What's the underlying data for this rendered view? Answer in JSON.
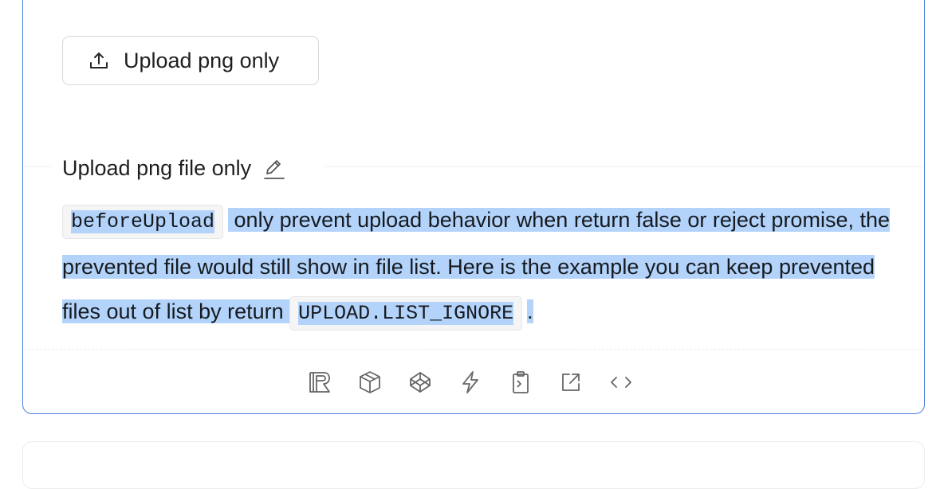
{
  "upload_button": {
    "label": "Upload png only",
    "icon": "upload-icon"
  },
  "demo": {
    "title": "Upload png file only",
    "edit_icon": "edit-icon",
    "description": {
      "code1": "beforeUpload",
      "text1": " only prevent upload behavior when return false or reject promise, the prevented file would still show in file list. Here is the example you can keep prevented files out of list by return ",
      "code2": "UPLOAD.LIST_IGNORE",
      "text2": "."
    }
  },
  "actions": [
    {
      "name": "riddle-icon"
    },
    {
      "name": "codesandbox-icon"
    },
    {
      "name": "codepen-icon"
    },
    {
      "name": "stackblitz-icon"
    },
    {
      "name": "copy-code-icon"
    },
    {
      "name": "open-in-new-window-icon"
    },
    {
      "name": "expand-code-icon"
    }
  ],
  "colors": {
    "card_border": "#4a7ee0",
    "selection": "#b3d3fa",
    "icon": "#666666"
  }
}
